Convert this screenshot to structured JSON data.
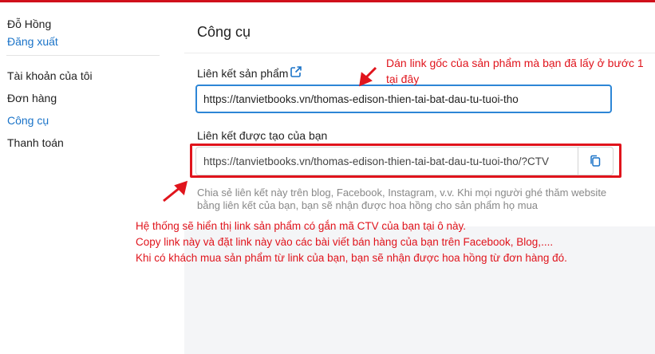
{
  "sidebar": {
    "user_name": "Đỗ Hồng",
    "logout": "Đăng xuất",
    "items": [
      {
        "label": "Tài khoản của tôi",
        "active": false
      },
      {
        "label": "Đơn hàng",
        "active": false
      },
      {
        "label": "Công cụ",
        "active": true
      },
      {
        "label": "Thanh toán",
        "active": false
      }
    ]
  },
  "main": {
    "title": "Công cụ",
    "product_link_label": "Liên kết sản phẩm",
    "product_link_icon": "external-link-icon",
    "product_link_value": "https://tanvietbooks.vn/thomas-edison-thien-tai-bat-dau-tu-tuoi-tho",
    "generated_link_label": "Liên kết được tạo của bạn",
    "generated_link_value": "https://tanvietbooks.vn/thomas-edison-thien-tai-bat-dau-tu-tuoi-tho/?CTV",
    "copy_icon": "copy-icon",
    "hint": "Chia sẻ liên kết này trên blog, Facebook, Instagram, v.v. Khi mọi người ghé thăm website bằng liên kết của bạn, bạn sẽ nhận được hoa hồng cho sản phẩm họ mua"
  },
  "annotations": {
    "top_line1": "Dán link gốc của sản phẩm mà bạn đã lấy ở bước 1",
    "top_line2": "tại đây",
    "bottom": [
      "Hệ thống sẽ hiển thị link sản phẩm có gắn mã CTV của bạn tại ô này.",
      "Copy link này và đặt link này vào các bài viết bán hàng của bạn trên Facebook, Blog,....",
      "Khi có khách mua sản phẩm từ link của bạn, bạn sẽ nhận được hoa hồng từ đơn hàng đó."
    ]
  },
  "colors": {
    "accent": "#1a73c8",
    "annotation_red": "#e0141c",
    "top_bar": "#d0101b"
  }
}
